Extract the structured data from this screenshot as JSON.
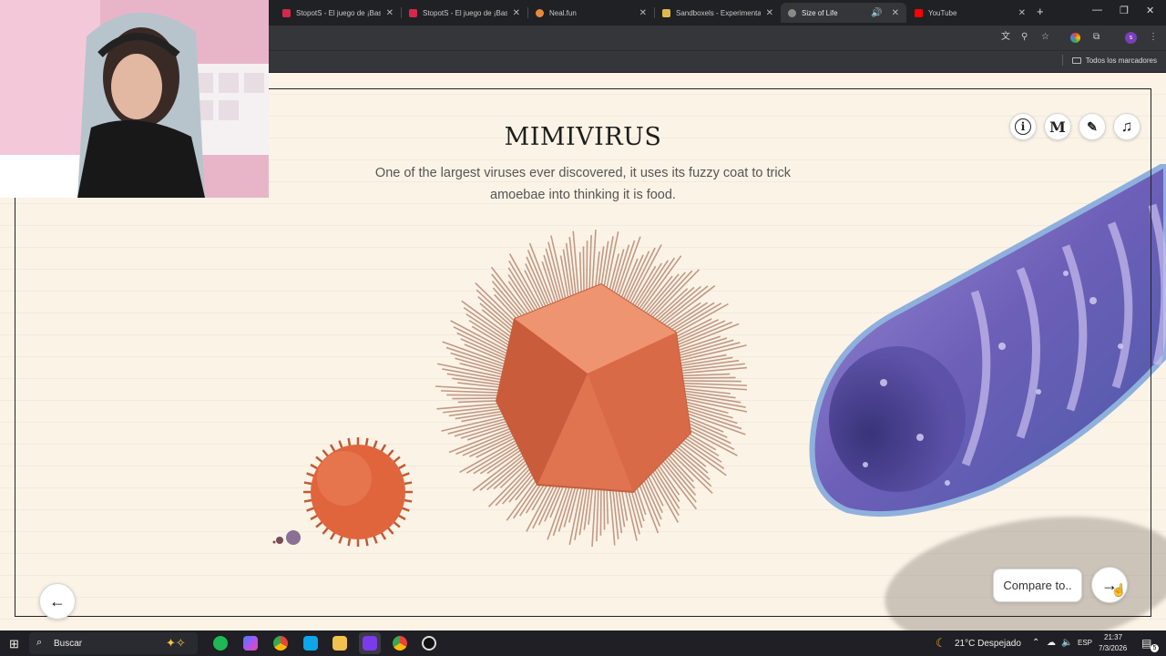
{
  "browser": {
    "tabs": [
      {
        "title": "StopotS - El juego de ¡Basta!",
        "color": "#d6284b",
        "active": false
      },
      {
        "title": "StopotS - El juego de ¡Basta!",
        "color": "#d6284b",
        "active": false
      },
      {
        "title": "Neal.fun",
        "color": "#e88a3c",
        "active": false
      },
      {
        "title": "Sandboxels - Experimental",
        "color": "#e0b94a",
        "active": false
      },
      {
        "title": "Size of Life",
        "color": "#8a8a8a",
        "active": true
      },
      {
        "title": "YouTube",
        "color": "#ff0000",
        "active": false
      }
    ],
    "bookmarks_all": "Todos los marcadores",
    "profile_initial": "s"
  },
  "page": {
    "title": "MIMIVIRUS",
    "description": "One of the largest viruses ever discovered, it uses its fuzzy coat to trick amoebae into thinking it is food.",
    "top_buttons": [
      {
        "icon": "info-icon",
        "glyph": "i"
      },
      {
        "icon": "medium-logo-icon",
        "glyph": "M"
      },
      {
        "icon": "ruler-icon",
        "glyph": "✎"
      },
      {
        "icon": "music-note-icon",
        "glyph": "♫"
      }
    ],
    "compare_label": "Compare to..",
    "prev_glyph": "←",
    "next_glyph": "→"
  },
  "taskbar": {
    "search_placeholder": "Buscar",
    "weather": "21°C  Despejado",
    "language": "ESP",
    "time": "21:37",
    "date": "7/3/2026",
    "notification_count": "5"
  }
}
